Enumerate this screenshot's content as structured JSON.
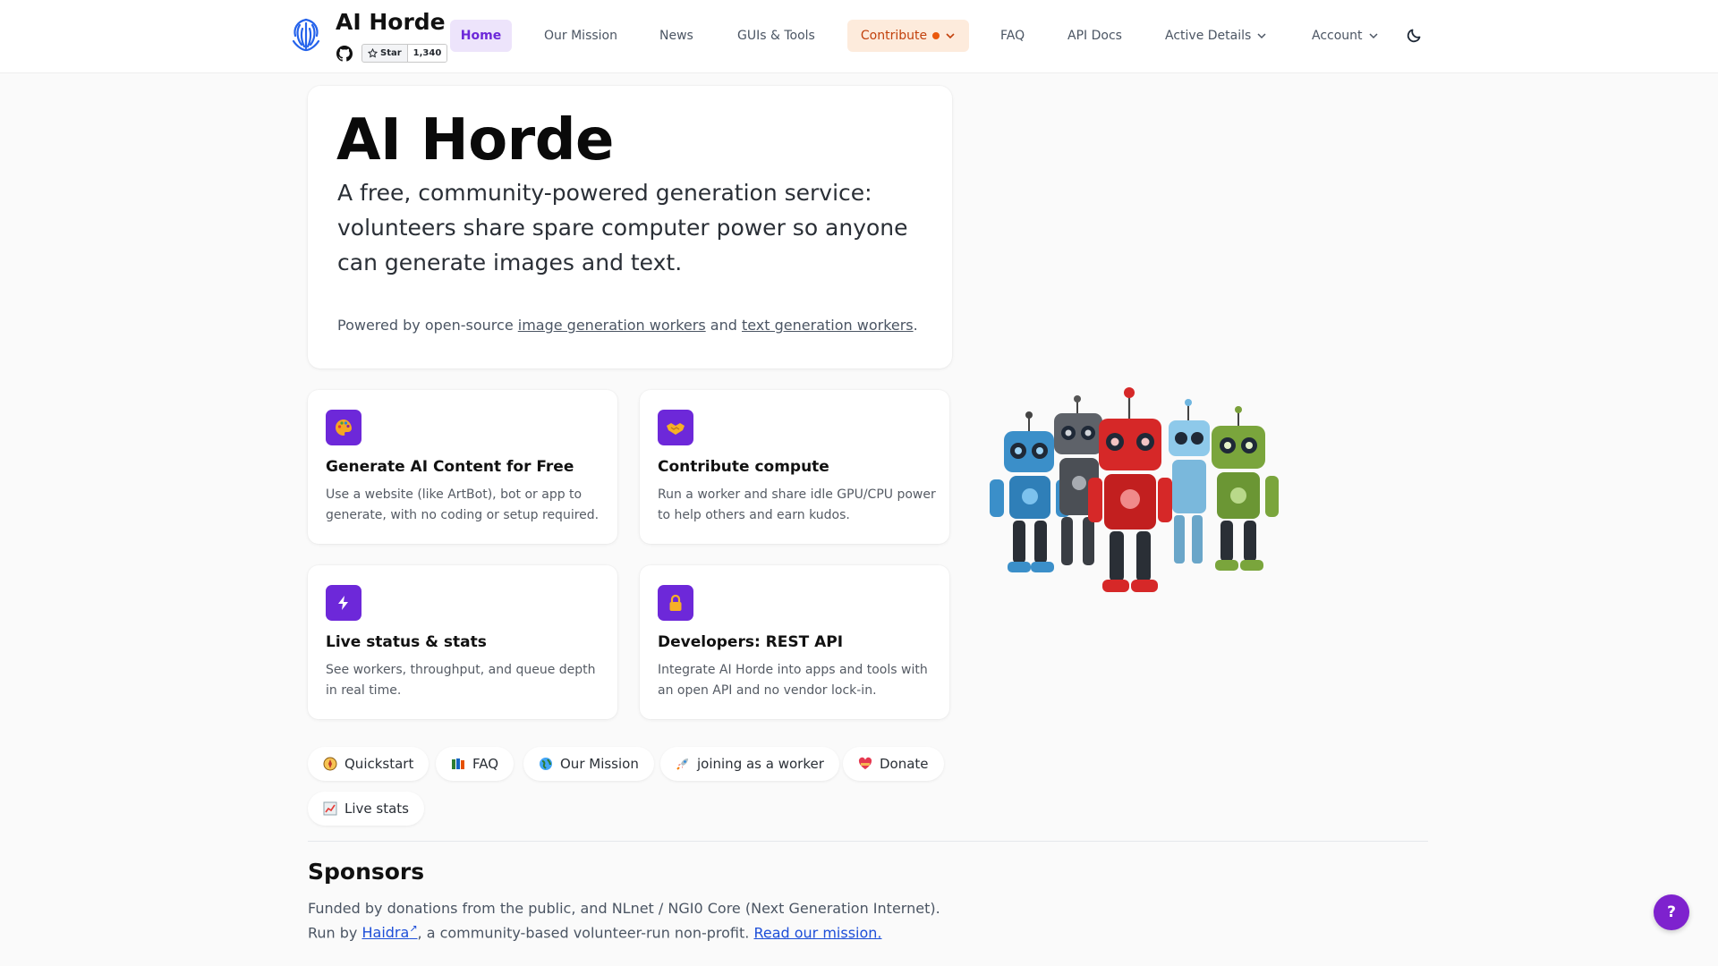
{
  "header": {
    "brand_title": "AI Horde",
    "github": {
      "star_label": "Star",
      "star_count": "1,340"
    },
    "nav": [
      {
        "label": "Home",
        "active": true
      },
      {
        "label": "Our Mission"
      },
      {
        "label": "News"
      },
      {
        "label": "GUIs & Tools"
      },
      {
        "label": "Contribute",
        "has_dot": true,
        "has_dropdown": true
      },
      {
        "label": "FAQ"
      },
      {
        "label": "API Docs"
      },
      {
        "label": "Active Details",
        "has_dropdown": true
      },
      {
        "label": "Account",
        "has_dropdown": true
      }
    ],
    "theme_toggle_icon": "moon-icon"
  },
  "hero": {
    "title": "AI Horde",
    "subtitle": "A free, community-powered generation service: volunteers share spare computer power so anyone can generate images and text.",
    "powered_prefix": "Powered by open-source ",
    "image_link": "image generation workers",
    "and": " and ",
    "text_link": "text generation workers",
    "suffix": "."
  },
  "features": [
    {
      "icon": "palette-icon",
      "title": "Generate AI Content for Free",
      "desc": "Use a website (like ArtBot), bot or app to generate, with no coding or setup required."
    },
    {
      "icon": "handshake-icon",
      "title": "Contribute compute",
      "desc": "Run a worker and share idle GPU/CPU power to help others and earn kudos."
    },
    {
      "icon": "lightning-icon",
      "title": "Live status & stats",
      "desc": "See workers, throughput, and queue depth in real time."
    },
    {
      "icon": "lock-icon",
      "title": "Developers: REST API",
      "desc": "Integrate AI Horde into apps and tools with an open API and no vendor lock-in."
    }
  ],
  "quick_links": [
    {
      "icon": "compass-icon",
      "label": "Quickstart"
    },
    {
      "icon": "books-icon",
      "label": "FAQ"
    },
    {
      "icon": "globe-icon",
      "label": "Our Mission"
    },
    {
      "icon": "rocket-icon",
      "label": "joining as a worker"
    },
    {
      "icon": "heart-icon",
      "label": "Donate"
    },
    {
      "icon": "chart-icon",
      "label": "Live stats"
    }
  ],
  "sponsors": {
    "title": "Sponsors",
    "line1": "Funded by donations from the public, and NLnet / NGI0 Core (Next Generation Internet).",
    "run_by": "Run by ",
    "haidra": "Haidra",
    "run_by_rest": ", a community-based volunteer-run non-profit. ",
    "mission_link": "Read our mission."
  },
  "help_button": "?",
  "colors": {
    "accent": "#6d28d9",
    "contribute_bg": "#fdebdc",
    "contribute_text": "#c2410c",
    "help_button": "#7e22ce",
    "link": "#1d4ed8"
  }
}
